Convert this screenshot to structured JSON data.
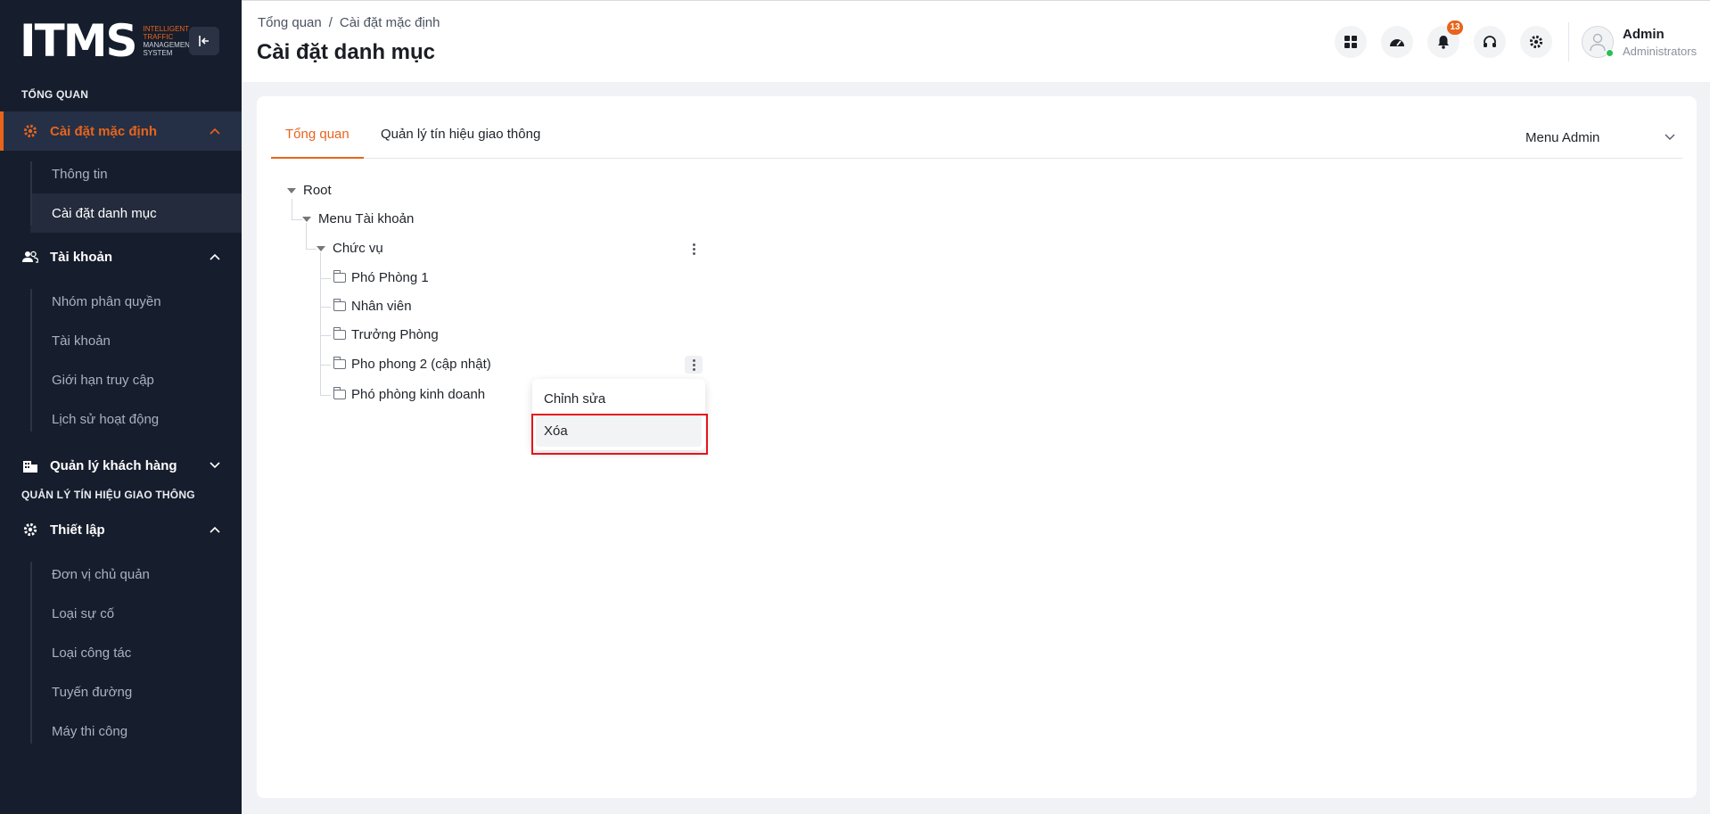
{
  "brand": {
    "mark": "ITMS",
    "tagline": [
      "INTELLIGENT",
      "TRAFFIC",
      "MANAGEMENT",
      "SYSTEM"
    ]
  },
  "sidebar": {
    "section_overview": "TỔNG QUAN",
    "group_default": {
      "label": "Cài đặt mặc định",
      "items": [
        "Thông tin",
        "Cài đặt danh mục"
      ]
    },
    "group_account": {
      "label": "Tài khoản",
      "items": [
        "Nhóm phân quyền",
        "Tài khoản",
        "Giới hạn truy cập",
        "Lịch sử hoạt động"
      ]
    },
    "group_customer": {
      "label": "Quản lý khách hàng"
    },
    "section_traffic": "QUẢN LÝ TÍN HIỆU GIAO THÔNG",
    "group_setup": {
      "label": "Thiết lập",
      "items": [
        "Đơn vị chủ quản",
        "Loại sự cố",
        "Loại công tác",
        "Tuyến đường",
        "Máy thi công"
      ]
    }
  },
  "header": {
    "breadcrumb": [
      "Tổng quan",
      "/",
      "Cài đặt mặc định"
    ],
    "title": "Cài đặt danh mục",
    "notification_count": "13",
    "user_name": "Admin",
    "user_role": "Administrators"
  },
  "tabs": [
    "Tổng quan",
    "Quản lý tín hiệu giao thông"
  ],
  "menu_select": {
    "value": "Menu Admin"
  },
  "tree": {
    "root": "Root",
    "account_menu": "Menu Tài khoản",
    "position": "Chức vụ",
    "leaves": [
      "Phó Phòng 1",
      "Nhân viên",
      "Trưởng Phòng",
      "Pho phong 2 (cập nhật)",
      "Phó phòng kinh doanh"
    ]
  },
  "context_menu": {
    "edit": "Chỉnh sửa",
    "delete": "Xóa"
  },
  "colors": {
    "accent": "#e8641b",
    "sidebar_bg": "#161d2c",
    "highlight": "#e5141b"
  }
}
